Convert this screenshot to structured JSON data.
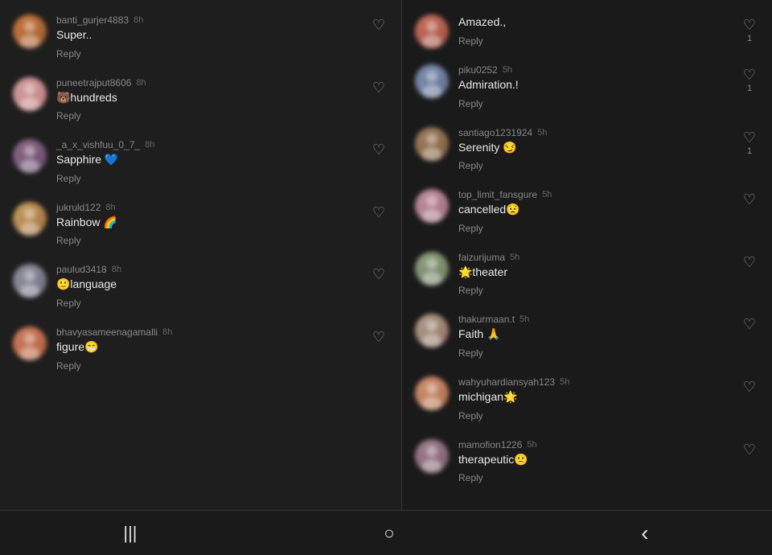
{
  "leftPanel": {
    "comments": [
      {
        "id": "l1",
        "username": "banti_gurjer4883",
        "time": "8h",
        "text": "Super..",
        "reply": "Reply",
        "avatarClass": "av-1",
        "hasCount": false
      },
      {
        "id": "l2",
        "username": "puneetrajput8606",
        "time": "8h",
        "text": "🐻hundreds",
        "reply": "Reply",
        "avatarClass": "av-2",
        "hasCount": false
      },
      {
        "id": "l3",
        "username": "_a_x_vishfuu_0_7_",
        "time": "8h",
        "text": "Sapphire 💙",
        "reply": "Reply",
        "avatarClass": "av-3",
        "hasCount": false
      },
      {
        "id": "l4",
        "username": "jukruld122",
        "time": "8h",
        "text": "Rainbow 🌈",
        "reply": "Reply",
        "avatarClass": "av-4",
        "hasCount": false
      },
      {
        "id": "l5",
        "username": "paulud3418",
        "time": "8h",
        "text": "🙂language",
        "reply": "Reply",
        "avatarClass": "av-5",
        "hasCount": false
      },
      {
        "id": "l6",
        "username": "bhavyasameenagamalli",
        "time": "8h",
        "text": "figure😁",
        "reply": "Reply",
        "avatarClass": "av-6",
        "hasCount": false
      }
    ]
  },
  "rightPanel": {
    "comments": [
      {
        "id": "r0",
        "username": "",
        "time": "",
        "text": "Amazed.,",
        "reply": "Reply",
        "avatarClass": "av-r1",
        "hasCount": true,
        "count": "1",
        "showHeader": false
      },
      {
        "id": "r1",
        "username": "piku0252",
        "time": "5h",
        "text": "Admiration.!",
        "reply": "Reply",
        "avatarClass": "av-r2",
        "hasCount": true,
        "count": "1"
      },
      {
        "id": "r2",
        "username": "santiago1231924",
        "time": "5h",
        "text": "Serenity 😏",
        "reply": "Reply",
        "avatarClass": "av-r3",
        "hasCount": true,
        "count": "1"
      },
      {
        "id": "r3",
        "username": "top_limit_fansgure",
        "time": "5h",
        "text": "cancelled😟",
        "reply": "Reply",
        "avatarClass": "av-r4",
        "hasCount": false
      },
      {
        "id": "r4",
        "username": "faizurijuma",
        "time": "5h",
        "text": "🌟theater",
        "reply": "Reply",
        "avatarClass": "av-r5",
        "hasCount": false
      },
      {
        "id": "r5",
        "username": "thakurmaan.t",
        "time": "5h",
        "text": "Faith 🙏",
        "reply": "Reply",
        "avatarClass": "av-r6",
        "hasCount": false
      },
      {
        "id": "r6",
        "username": "wahyuhardiansyah123",
        "time": "5h",
        "text": "michigan🌟",
        "reply": "Reply",
        "avatarClass": "av-r7",
        "hasCount": false
      },
      {
        "id": "r7",
        "username": "mamofion1226",
        "time": "5h",
        "text": "therapeutic🙁",
        "reply": "Reply",
        "avatarClass": "av-r8",
        "hasCount": false
      }
    ]
  },
  "navBar": {
    "icons": [
      "|||",
      "○",
      "‹"
    ]
  }
}
